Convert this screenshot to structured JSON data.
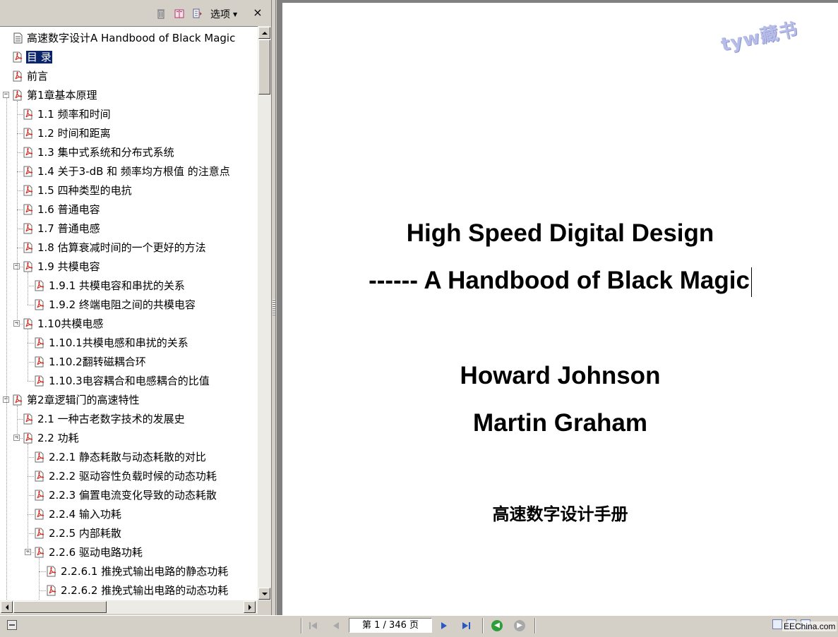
{
  "panel_toolbar": {
    "options_label": "选项",
    "close_label": "×"
  },
  "bookmarks": [
    {
      "label": "高速数字设计A Handbood of Black Magic",
      "level": 0,
      "icon": "document-icon",
      "toggle": ""
    },
    {
      "label": "目 录",
      "level": 0,
      "icon": "pdf-bookmark-icon",
      "toggle": "",
      "selected": true
    },
    {
      "label": "前言",
      "level": 0,
      "icon": "pdf-bookmark-icon",
      "toggle": ""
    },
    {
      "label": "第1章基本原理",
      "level": 0,
      "icon": "pdf-bookmark-icon",
      "toggle": "−"
    },
    {
      "label": "1.1 频率和时间",
      "level": 1,
      "icon": "pdf-bookmark-icon",
      "toggle": ""
    },
    {
      "label": "1.2 时间和距离",
      "level": 1,
      "icon": "pdf-bookmark-icon",
      "toggle": ""
    },
    {
      "label": "1.3 集中式系统和分布式系统",
      "level": 1,
      "icon": "pdf-bookmark-icon",
      "toggle": ""
    },
    {
      "label": "1.4 关于3-dB 和 频率均方根值 的注意点",
      "level": 1,
      "icon": "pdf-bookmark-icon",
      "toggle": ""
    },
    {
      "label": "1.5 四种类型的电抗",
      "level": 1,
      "icon": "pdf-bookmark-icon",
      "toggle": ""
    },
    {
      "label": "1.6 普通电容",
      "level": 1,
      "icon": "pdf-bookmark-icon",
      "toggle": ""
    },
    {
      "label": "1.7 普通电感",
      "level": 1,
      "icon": "pdf-bookmark-icon",
      "toggle": ""
    },
    {
      "label": "1.8 估算衰减时间的一个更好的方法",
      "level": 1,
      "icon": "pdf-bookmark-icon",
      "toggle": ""
    },
    {
      "label": "1.9 共模电容",
      "level": 1,
      "icon": "pdf-bookmark-icon",
      "toggle": "−"
    },
    {
      "label": "1.9.1 共模电容和串扰的关系",
      "level": 2,
      "icon": "pdf-bookmark-icon",
      "toggle": ""
    },
    {
      "label": "1.9.2 终端电阻之间的共模电容",
      "level": 2,
      "icon": "pdf-bookmark-icon",
      "toggle": ""
    },
    {
      "label": "1.10共模电感",
      "level": 1,
      "icon": "pdf-bookmark-icon",
      "toggle": "−"
    },
    {
      "label": "1.10.1共模电感和串扰的关系",
      "level": 2,
      "icon": "pdf-bookmark-icon",
      "toggle": ""
    },
    {
      "label": "1.10.2翻转磁耦合环",
      "level": 2,
      "icon": "pdf-bookmark-icon",
      "toggle": ""
    },
    {
      "label": "1.10.3电容耦合和电感耦合的比值",
      "level": 2,
      "icon": "pdf-bookmark-icon",
      "toggle": ""
    },
    {
      "label": "第2章逻辑门的高速特性",
      "level": 0,
      "icon": "pdf-bookmark-icon",
      "toggle": "−"
    },
    {
      "label": "2.1 一种古老数字技术的发展史",
      "level": 1,
      "icon": "pdf-bookmark-icon",
      "toggle": ""
    },
    {
      "label": "2.2 功耗",
      "level": 1,
      "icon": "pdf-bookmark-icon",
      "toggle": "−"
    },
    {
      "label": "2.2.1 静态耗散与动态耗散的对比",
      "level": 2,
      "icon": "pdf-bookmark-icon",
      "toggle": ""
    },
    {
      "label": "2.2.2 驱动容性负载时候的动态功耗",
      "level": 2,
      "icon": "pdf-bookmark-icon",
      "toggle": ""
    },
    {
      "label": "2.2.3 偏置电流变化导致的动态耗散",
      "level": 2,
      "icon": "pdf-bookmark-icon",
      "toggle": ""
    },
    {
      "label": "2.2.4 输入功耗",
      "level": 2,
      "icon": "pdf-bookmark-icon",
      "toggle": ""
    },
    {
      "label": "2.2.5 内部耗散",
      "level": 2,
      "icon": "pdf-bookmark-icon",
      "toggle": ""
    },
    {
      "label": "2.2.6 驱动电路功耗",
      "level": 2,
      "icon": "pdf-bookmark-icon",
      "toggle": "−"
    },
    {
      "label": "2.2.6.1 推挽式输出电路的静态功耗",
      "level": 3,
      "icon": "pdf-bookmark-icon",
      "toggle": ""
    },
    {
      "label": "2.2.6.2 推挽式输出电路的动态功耗",
      "level": 3,
      "icon": "pdf-bookmark-icon",
      "toggle": ""
    }
  ],
  "document": {
    "title_line1": "High Speed Digital Design",
    "title_line2": "------ A Handbood of Black Magic",
    "author1": "Howard Johnson",
    "author2": "Martin Graham",
    "chinese_title": "高速数字设计手册",
    "watermark": "tyw藏书"
  },
  "status_bar": {
    "page_indicator": "第 1 / 346 页",
    "site_label": "EEChina.com"
  },
  "colors": {
    "selection": "#0a246a",
    "nav_green": "#2f9e3a",
    "nav_gray": "#a8a8a8",
    "nav_blue": "#2a56c6"
  }
}
